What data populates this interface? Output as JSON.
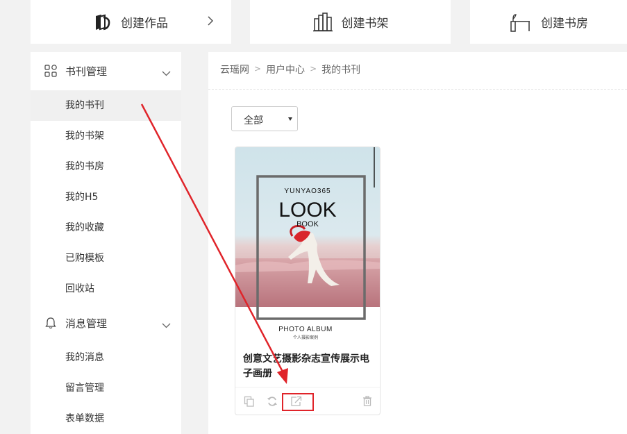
{
  "top_actions": {
    "create_works": "创建作品",
    "create_shelf": "创建书架",
    "create_study": "创建书房"
  },
  "sidebar": {
    "groups": [
      {
        "label": "书刊管理",
        "icon": "grid-icon",
        "items": [
          "我的书刊",
          "我的书架",
          "我的书房",
          "我的H5",
          "我的收藏",
          "已购模板",
          "回收站"
        ]
      },
      {
        "label": "消息管理",
        "icon": "bell-icon",
        "items": [
          "我的消息",
          "留言管理",
          "表单数据"
        ]
      }
    ],
    "active_item": "我的书刊"
  },
  "breadcrumb": {
    "items": [
      "云瑶网",
      "用户中心",
      "我的书刊"
    ],
    "separator": ">"
  },
  "filter": {
    "selected": "全部"
  },
  "book": {
    "cover_brand": "YUNYAO365",
    "cover_title": "LOOK",
    "cover_subtitle": "BOOK",
    "cover_footer": "PHOTO ALBUM",
    "cover_footer_sub": "个人摄影案例",
    "title": "创意文艺摄影杂志宣传展示电子画册"
  },
  "colors": {
    "accent_red": "#e0242a",
    "page_bg": "#f2f2f2",
    "active_item_bg": "#f0f0f0"
  }
}
